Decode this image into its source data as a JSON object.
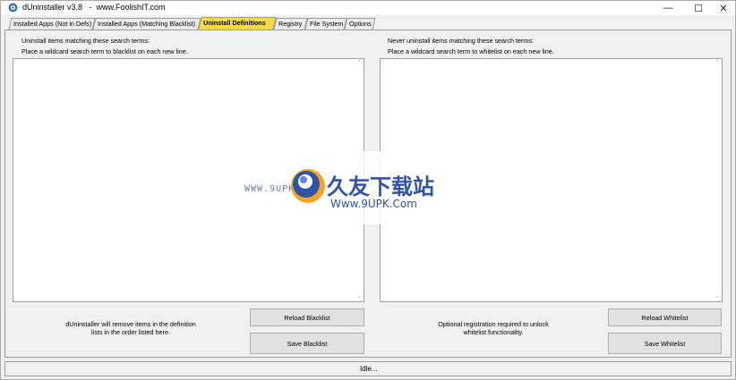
{
  "window": {
    "title": "dUninstaller v3.8   -  www.FoolishIT.com",
    "minimize_glyph": "—",
    "maximize_glyph": "☐",
    "close_glyph": "✕"
  },
  "tabs": [
    {
      "label": "Installed Apps (Not in Defs)",
      "active": false
    },
    {
      "label": "Installed Apps (Matching Blacklist)",
      "active": false
    },
    {
      "label": "Uninstall Definitions",
      "active": true
    },
    {
      "label": "Registry",
      "active": false
    },
    {
      "label": "File System",
      "active": false
    },
    {
      "label": "Options",
      "active": false
    }
  ],
  "blacklist": {
    "heading": "Uninstall items matching these search terms:",
    "instruction": "Place a wildcard search term to blacklist on each new line.",
    "value": "",
    "note_line1": "dUninstaller will remove items in the definition",
    "note_line2": "lists in the order listed here.",
    "reload_label": "Reload Blacklist",
    "save_label": "Save Blacklist"
  },
  "whitelist": {
    "heading": "Never uninstall items matching these search terms:",
    "instruction": "Place a wildcard search term to whitelist on each new line.",
    "value": "",
    "note_line1": "Optional registration required to unlock",
    "note_line2": "whitelist functionality.",
    "reload_label": "Reload Whitelist",
    "save_label": "Save Whitelist"
  },
  "status": {
    "text": "Idle..."
  },
  "watermark": {
    "left_text": "WWW.9UPK.COM",
    "brand_cn": "久友下载站",
    "url": "Www.9UPK.Com"
  },
  "colors": {
    "active_tab": "#f5d84c",
    "button_face": "#e1e1e1",
    "window_bg": "#f0f0f0",
    "watermark_blue": "#2f53a8"
  }
}
